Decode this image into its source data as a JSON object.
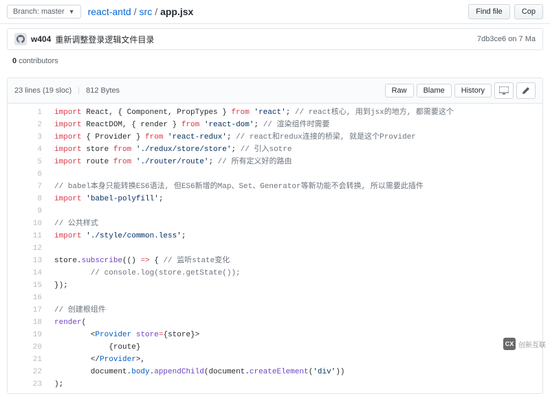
{
  "branch": {
    "label": "Branch:",
    "value": "master"
  },
  "breadcrumb": {
    "repo": "react-antd",
    "dir": "src",
    "file": "app.jsx",
    "sep": "/"
  },
  "buttons": {
    "find_file": "Find file",
    "copy": "Cop"
  },
  "commit": {
    "author": "w404",
    "message": "重新调整登录逻辑文件目录",
    "hash": "7db3ce6",
    "when": "on 7 Ma"
  },
  "contrib": {
    "count": "0",
    "label": "contributors"
  },
  "file": {
    "lines": "23 lines (19 sloc)",
    "size": "812 Bytes",
    "raw": "Raw",
    "blame": "Blame",
    "history": "History"
  },
  "code": {
    "line_count": 23,
    "lines": [
      [
        [
          "k",
          "import"
        ],
        [
          "v",
          " React, { Component, PropTypes } "
        ],
        [
          "k",
          "from"
        ],
        [
          "v",
          " "
        ],
        [
          "s",
          "'react'"
        ],
        [
          "v",
          "; "
        ],
        [
          "c",
          "// react核心, 用到jsx的地方, 都需要这个"
        ]
      ],
      [
        [
          "k",
          "import"
        ],
        [
          "v",
          " ReactDOM, { render } "
        ],
        [
          "k",
          "from"
        ],
        [
          "v",
          " "
        ],
        [
          "s",
          "'react-dom'"
        ],
        [
          "v",
          "; "
        ],
        [
          "c",
          "// 渲染组件时需要"
        ]
      ],
      [
        [
          "k",
          "import"
        ],
        [
          "v",
          " { Provider } "
        ],
        [
          "k",
          "from"
        ],
        [
          "v",
          " "
        ],
        [
          "s",
          "'react-redux'"
        ],
        [
          "v",
          "; "
        ],
        [
          "c",
          "// react和redux连接的桥梁, 就是这个Provider"
        ]
      ],
      [
        [
          "k",
          "import"
        ],
        [
          "v",
          " store "
        ],
        [
          "k",
          "from"
        ],
        [
          "v",
          " "
        ],
        [
          "s",
          "'./redux/store/store'"
        ],
        [
          "v",
          "; "
        ],
        [
          "c",
          "// 引入sotre"
        ]
      ],
      [
        [
          "k",
          "import"
        ],
        [
          "v",
          " route "
        ],
        [
          "k",
          "from"
        ],
        [
          "v",
          " "
        ],
        [
          "s",
          "'./router/route'"
        ],
        [
          "v",
          "; "
        ],
        [
          "c",
          "// 所有定义好的路由"
        ]
      ],
      [],
      [
        [
          "c",
          "// babel本身只能转换ES6语法, 但ES6新增的Map、Set、Generator等新功能不会转换, 所以需要此插件"
        ]
      ],
      [
        [
          "k",
          "import"
        ],
        [
          "v",
          " "
        ],
        [
          "s",
          "'babel-polyfill'"
        ],
        [
          "v",
          ";"
        ]
      ],
      [],
      [
        [
          "c",
          "// 公共样式"
        ]
      ],
      [
        [
          "k",
          "import"
        ],
        [
          "v",
          " "
        ],
        [
          "s",
          "'./style/common.less'"
        ],
        [
          "v",
          ";"
        ]
      ],
      [],
      [
        [
          "v",
          "store."
        ],
        [
          "fn",
          "subscribe"
        ],
        [
          "v",
          "(() "
        ],
        [
          "k",
          "=>"
        ],
        [
          "v",
          " { "
        ],
        [
          "c",
          "// 监听state变化"
        ]
      ],
      [
        [
          "v",
          "        "
        ],
        [
          "c",
          "// console.log(store.getState());"
        ]
      ],
      [
        [
          "v",
          "});"
        ]
      ],
      [],
      [
        [
          "c",
          "// 创建根组件"
        ]
      ],
      [
        [
          "fn",
          "render"
        ],
        [
          "v",
          "("
        ]
      ],
      [
        [
          "v",
          "        <"
        ],
        [
          "id",
          "Provider"
        ],
        [
          "v",
          " "
        ],
        [
          "fn",
          "store"
        ],
        [
          "k",
          "="
        ],
        [
          "v",
          "{store}>"
        ]
      ],
      [
        [
          "v",
          "            {route}"
        ]
      ],
      [
        [
          "v",
          "        </"
        ],
        [
          "id",
          "Provider"
        ],
        [
          "v",
          ">,"
        ]
      ],
      [
        [
          "v",
          "        document."
        ],
        [
          "id",
          "body"
        ],
        [
          "v",
          "."
        ],
        [
          "fn",
          "appendChild"
        ],
        [
          "v",
          "(document."
        ],
        [
          "fn",
          "createElement"
        ],
        [
          "v",
          "("
        ],
        [
          "s",
          "'div'"
        ],
        [
          "v",
          "))"
        ]
      ],
      [
        [
          "v",
          ");"
        ]
      ]
    ]
  },
  "watermark": {
    "mark": "CX",
    "text": "创新互联"
  }
}
